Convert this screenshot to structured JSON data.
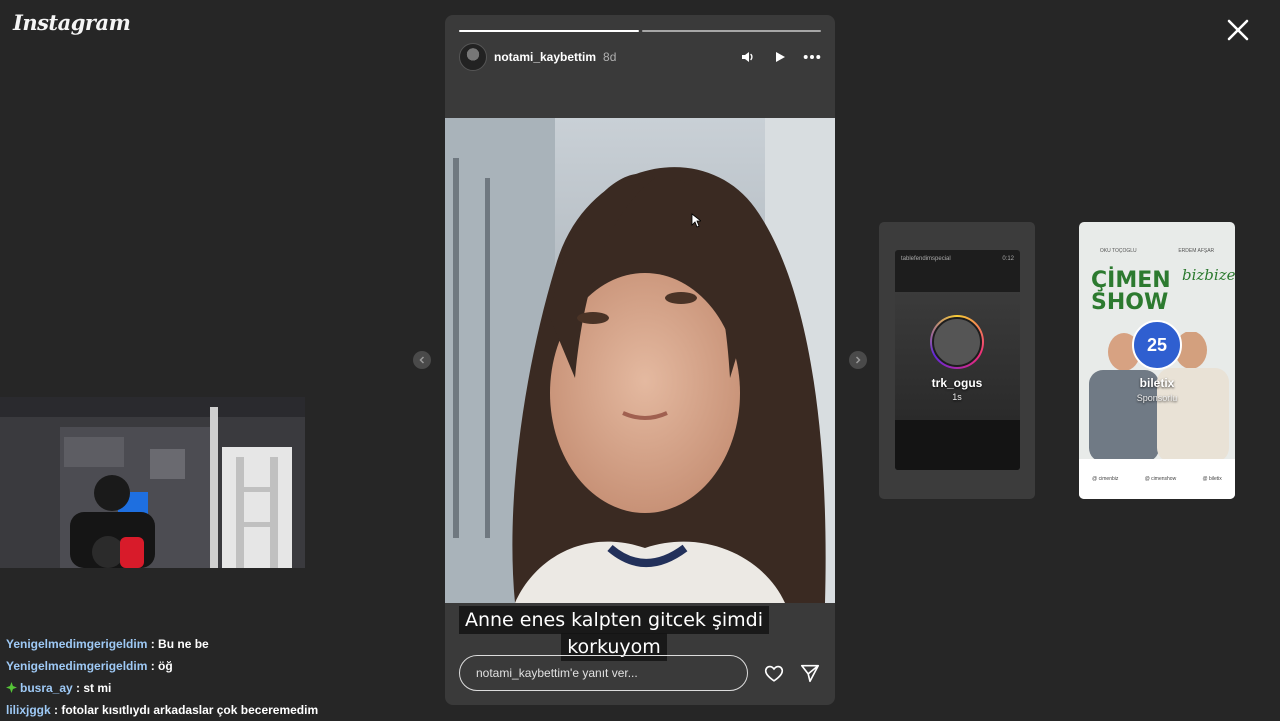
{
  "app": {
    "logo": "Instagram"
  },
  "story": {
    "username": "notami_kaybettim",
    "time": "8d",
    "progress": [
      1,
      0
    ],
    "caption_line1": "Anne enes kalpten gitcek şimdi",
    "caption_line2": "korkuyom",
    "reply_placeholder": "notami_kaybettim'e yanıt ver...",
    "icons": [
      "volume-icon",
      "play-icon",
      "more-icon",
      "heart-icon",
      "send-icon"
    ]
  },
  "previews": [
    {
      "header_left": "tablefendimspecial",
      "header_right": "0:12",
      "name": "trk_ogus",
      "subtitle": "1s"
    },
    {
      "top_left": "OKU TOÇOGLU",
      "top_right": "ERDEM AFŞAR",
      "title_line1": "ÇİMEN",
      "title_line2": "SHOW",
      "title_script": "bizbize",
      "badge": "25",
      "name": "biletix",
      "subtitle": "Sponsorlu",
      "footer": [
        "@ cimenbiz",
        "@ cimenshow",
        "@ biletix"
      ]
    }
  ],
  "chat": [
    {
      "user": "Yenigelmedimgerigeldim",
      "message": "Bu ne be",
      "badge": false
    },
    {
      "user": "Yenigelmedimgerigeldim",
      "message": "öğ",
      "badge": false
    },
    {
      "user": "busra_ay",
      "message": "st mi",
      "badge": true
    },
    {
      "user": "lilixjggk",
      "message": "fotolar kısıtlıydı arkadaslar çok beceremedim",
      "badge": false
    }
  ],
  "colors": {
    "background": "#262626",
    "story_bg": "#3a3a3a",
    "chat_user": "#9ec9f5",
    "badge_green": "#55c437"
  }
}
